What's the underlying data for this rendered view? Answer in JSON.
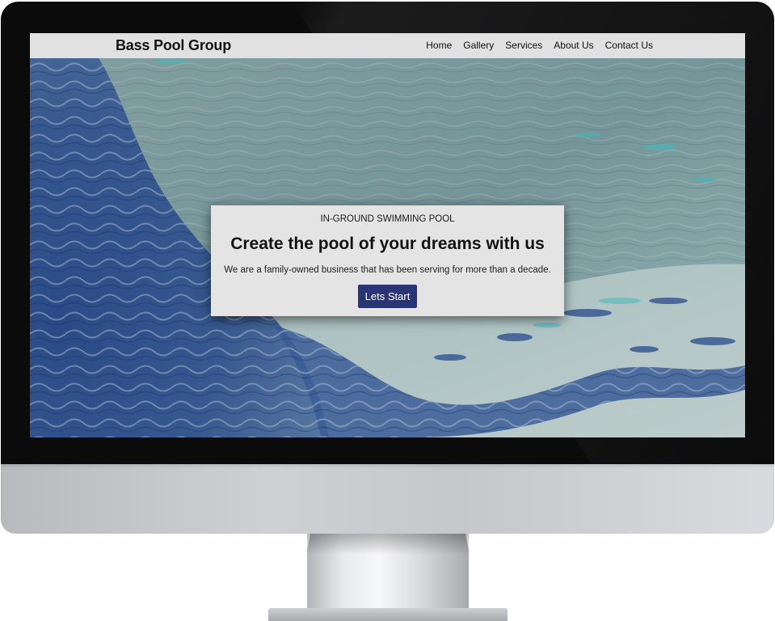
{
  "site": {
    "brand": "Bass Pool Group",
    "nav": [
      "Home",
      "Gallery",
      "Services",
      "About Us",
      "Contact Us"
    ]
  },
  "hero": {
    "eyebrow": "IN-GROUND SWIMMING POOL",
    "headline": "Create the pool of your dreams with us",
    "subline": "We are a family-owned business that has been serving for more than a decade.",
    "cta_label": "Lets Start"
  },
  "colors": {
    "navbar_bg": "#e1e1e1",
    "card_bg": "#e4e4e4",
    "cta_bg": "#2a3576",
    "cta_text": "#ffffff"
  },
  "background_image": "water-ripple-photo"
}
